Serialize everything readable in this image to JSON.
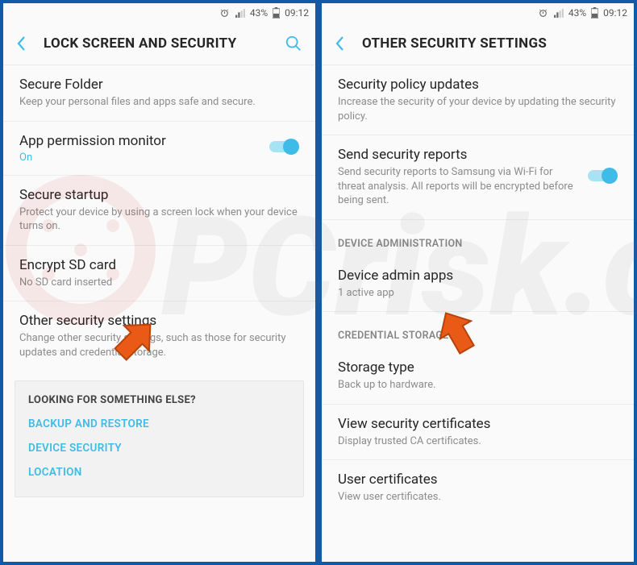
{
  "status": {
    "battery": "43%",
    "time": "09:12"
  },
  "left": {
    "title": "LOCK SCREEN AND SECURITY",
    "items": {
      "secure_folder": {
        "title": "Secure Folder",
        "sub": "Keep your personal files and apps safe and secure."
      },
      "app_perm": {
        "title": "App permission monitor",
        "status": "On"
      },
      "secure_startup": {
        "title": "Secure startup",
        "sub": "Protect your device by using a screen lock when your device turns on."
      },
      "encrypt_sd": {
        "title": "Encrypt SD card",
        "sub": "No SD card inserted"
      },
      "other_sec": {
        "title": "Other security settings",
        "sub": "Change other security settings, such as those for security updates and credential storage."
      }
    },
    "footer": {
      "title": "LOOKING FOR SOMETHING ELSE?",
      "links": {
        "backup": "BACKUP AND RESTORE",
        "dev_sec": "DEVICE SECURITY",
        "location": "LOCATION"
      }
    }
  },
  "right": {
    "title": "OTHER SECURITY SETTINGS",
    "items": {
      "policy": {
        "title": "Security policy updates",
        "sub": "Increase the security of your device by updating the security policy."
      },
      "reports": {
        "title": "Send security reports",
        "sub": "Send security reports to Samsung via Wi-Fi for threat analysis. All reports will be encrypted before being sent."
      },
      "admin_apps": {
        "title": "Device admin apps",
        "sub": "1 active app"
      },
      "storage_type": {
        "title": "Storage type",
        "sub": "Back up to hardware."
      },
      "view_certs": {
        "title": "View security certificates",
        "sub": "Display trusted CA certificates."
      },
      "user_certs": {
        "title": "User certificates",
        "sub": "View user certificates."
      }
    },
    "sections": {
      "dev_admin": "DEVICE ADMINISTRATION",
      "cred_store": "CREDENTIAL STORAGE"
    }
  },
  "watermark": "PCrisk.com"
}
